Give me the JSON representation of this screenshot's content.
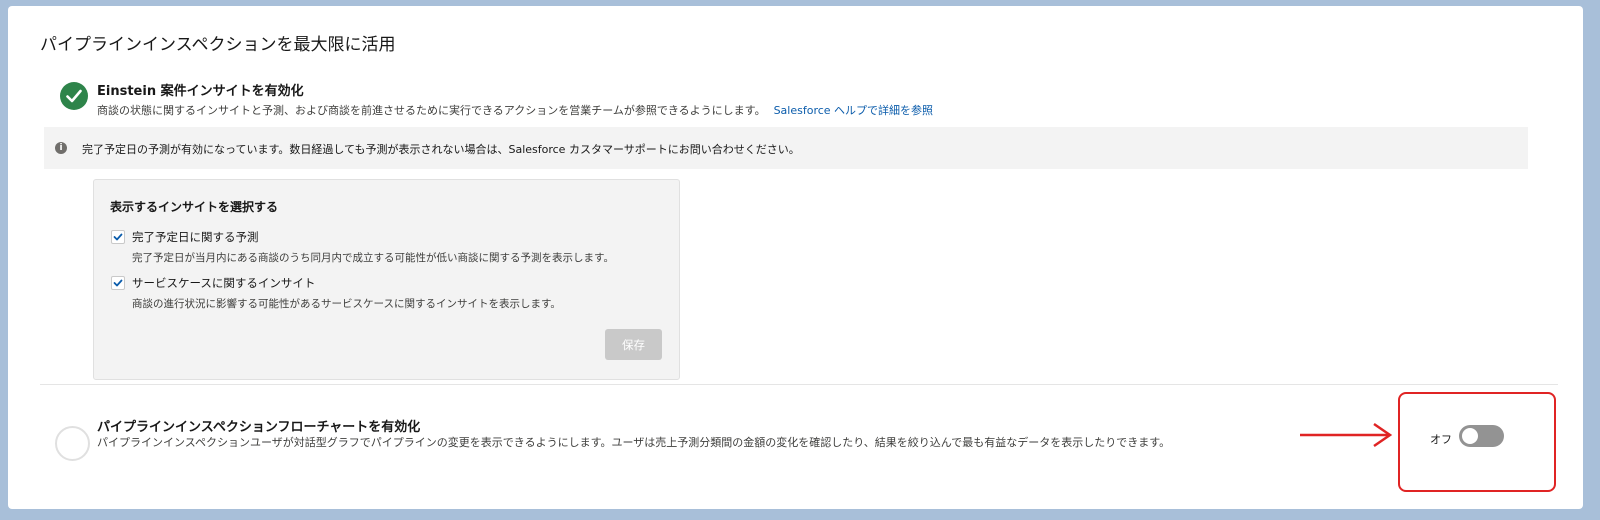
{
  "page": {
    "title": "パイプラインインスペクションを最大限に活用"
  },
  "einstein_section": {
    "title": "Einstein 案件インサイトを有効化",
    "description": "商談の状態に関するインサイトと予測、および商談を前進させるために実行できるアクションを営業チームが参照できるようにします。",
    "help_link": "Salesforce ヘルプで詳細を参照",
    "status_icon": "check-icon",
    "status_color": "#2e844a"
  },
  "info_bar": {
    "icon": "info-icon",
    "text": "完了予定日の予測が有効になっています。数日経過しても予測が表示されない場合は、Salesforce カスタマーサポートにお問い合わせください。"
  },
  "insight_box": {
    "title": "表示するインサイトを選択する",
    "options": [
      {
        "label": "完了予定日に関する予測",
        "description": "完了予定日が当月内にある商談のうち同月内で成立する可能性が低い商談に関する予測を表示します。",
        "checked": true
      },
      {
        "label": "サービスケースに関するインサイト",
        "description": "商談の進行状況に影響する可能性があるサービスケースに関するインサイトを表示します。",
        "checked": true
      }
    ],
    "save_label": "保存"
  },
  "flowchart_section": {
    "title": "パイプラインインスペクションフローチャートを有効化",
    "description": "パイプラインインスペクションユーザが対話型グラフでパイプラインの変更を表示できるようにします。ユーザは売上予測分類間の金額の変化を確認したり、結果を絞り込んで最も有益なデータを表示したりできます。",
    "toggle_label": "オフ",
    "toggle_state": "off"
  },
  "annotation": {
    "color": "#e02424"
  }
}
